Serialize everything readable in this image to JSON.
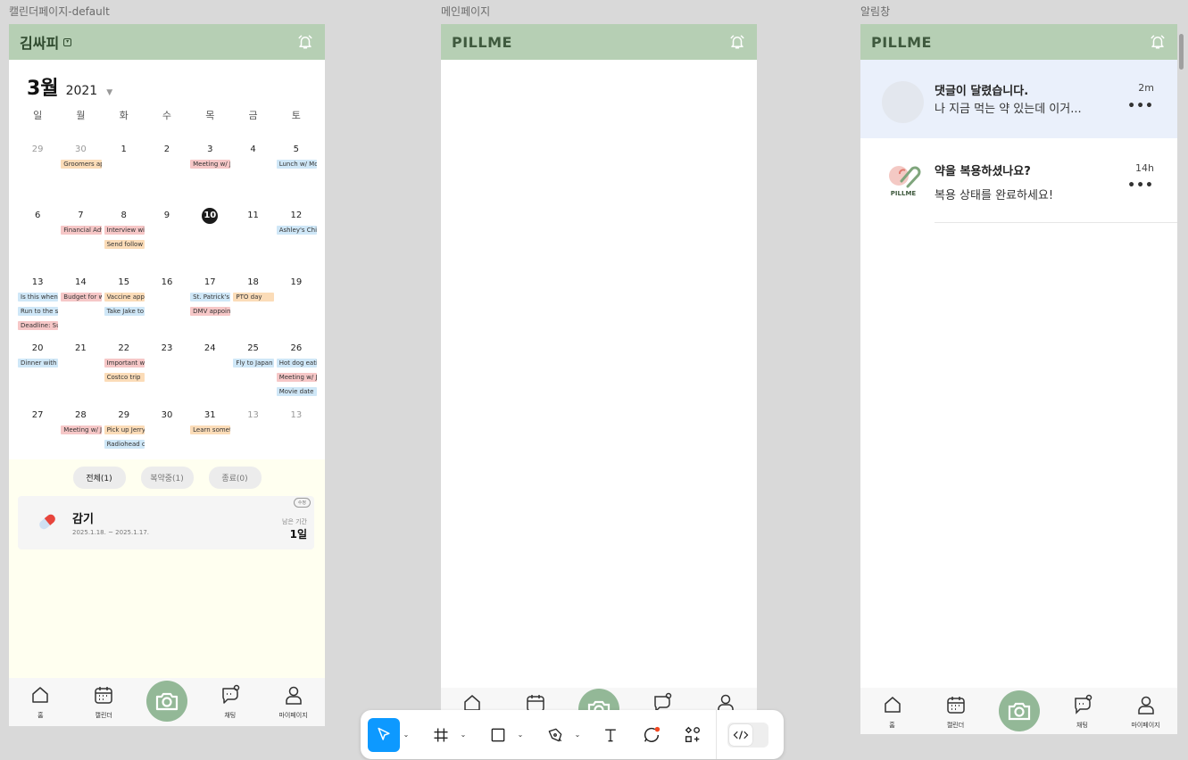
{
  "frames": {
    "calendar_label": "캘린더페이지-default",
    "main_label": "메인페이지",
    "notification_label": "알림창"
  },
  "colors": {
    "header": "#b6cfb4",
    "camera": "#93b897",
    "toolbar_active": "#0d99ff",
    "unread_bg": "#eaf0fb"
  },
  "calendar": {
    "user_name": "김싸피",
    "month": "3월",
    "year": "2021",
    "weekdays": [
      "일",
      "월",
      "화",
      "수",
      "목",
      "금",
      "토"
    ],
    "weeks": [
      [
        {
          "n": "29",
          "muted": true,
          "events": []
        },
        {
          "n": "30",
          "muted": true,
          "events": [
            {
              "t": "Groomers appt",
              "c": "orange"
            }
          ]
        },
        {
          "n": "1",
          "events": []
        },
        {
          "n": "2",
          "events": []
        },
        {
          "n": "3",
          "events": [
            {
              "t": "Meeting w/ Jo",
              "c": "pink"
            }
          ]
        },
        {
          "n": "4",
          "events": []
        },
        {
          "n": "5",
          "events": [
            {
              "t": "Lunch w/ Mom",
              "c": "blue"
            }
          ]
        }
      ],
      [
        {
          "n": "6",
          "events": []
        },
        {
          "n": "7",
          "events": [
            {
              "t": "Financial Advisor",
              "c": "pink"
            }
          ]
        },
        {
          "n": "8",
          "events": [
            {
              "t": "Interview with",
              "c": "pink"
            },
            {
              "t": "Send follow up",
              "c": "orange"
            }
          ]
        },
        {
          "n": "9",
          "events": []
        },
        {
          "n": "10",
          "today": true,
          "events": []
        },
        {
          "n": "11",
          "events": []
        },
        {
          "n": "12",
          "events": [
            {
              "t": "Ashley's Children",
              "c": "blue"
            }
          ]
        }
      ],
      [
        {
          "n": "13",
          "events": [
            {
              "t": "Is this when",
              "c": "blue"
            },
            {
              "t": "Run to the store",
              "c": "blue"
            },
            {
              "t": "Deadline: Submit",
              "c": "pink"
            }
          ]
        },
        {
          "n": "14",
          "events": [
            {
              "t": "Budget for week",
              "c": "pink"
            }
          ]
        },
        {
          "n": "15",
          "events": [
            {
              "t": "Vaccine appt",
              "c": "orange"
            },
            {
              "t": "Take Jake to",
              "c": "blue"
            }
          ]
        },
        {
          "n": "16",
          "events": []
        },
        {
          "n": "17",
          "events": [
            {
              "t": "St. Patrick's Day",
              "c": "blue"
            },
            {
              "t": "DMV appointment",
              "c": "pink"
            }
          ]
        },
        {
          "n": "18",
          "events": [
            {
              "t": "PTO day",
              "c": "orange"
            }
          ]
        },
        {
          "n": "19",
          "events": []
        }
      ],
      [
        {
          "n": "20",
          "events": [
            {
              "t": "Dinner with",
              "c": "blue"
            }
          ]
        },
        {
          "n": "21",
          "events": []
        },
        {
          "n": "22",
          "events": [
            {
              "t": "Important work",
              "c": "pink"
            },
            {
              "t": "Costco trip",
              "c": "orange"
            }
          ]
        },
        {
          "n": "23",
          "events": []
        },
        {
          "n": "24",
          "events": []
        },
        {
          "n": "25",
          "events": [
            {
              "t": "Fly to Japan",
              "c": "blue"
            }
          ]
        },
        {
          "n": "26",
          "events": [
            {
              "t": "Hot dog eating",
              "c": "blue"
            },
            {
              "t": "Meeting w/ Jo",
              "c": "pink"
            },
            {
              "t": "Movie date",
              "c": "blue"
            }
          ]
        }
      ],
      [
        {
          "n": "27",
          "events": []
        },
        {
          "n": "28",
          "events": [
            {
              "t": "Meeting w/ Jo",
              "c": "pink"
            }
          ]
        },
        {
          "n": "29",
          "events": [
            {
              "t": "Pick up Jerry",
              "c": "orange"
            },
            {
              "t": "Radiohead concert",
              "c": "blue"
            }
          ]
        },
        {
          "n": "30",
          "events": []
        },
        {
          "n": "31",
          "events": [
            {
              "t": "Learn something",
              "c": "orange"
            }
          ]
        },
        {
          "n": "13",
          "muted": true,
          "events": []
        },
        {
          "n": "13",
          "muted": true,
          "events": []
        }
      ]
    ],
    "filter_tabs": [
      "전체(1)",
      "복약중(1)",
      "종료(0)"
    ],
    "medication": {
      "name": "감기",
      "dates": "2025.1.18. ~ 2025.1.17.",
      "edit_label": "수정",
      "remaining_label": "남은 기간",
      "remaining_value": "1일"
    }
  },
  "brand": "PILLME",
  "nav": {
    "home": "홈",
    "calendar": "캘린더",
    "chat": "채팅",
    "mypage": "마이페이지"
  },
  "notifications": [
    {
      "title": "댓글이 달렸습니다.",
      "body": "나 지금 먹는 약 있는데 이거...",
      "time": "2m",
      "more": "•••"
    },
    {
      "title": "약을 복용하셨나요?",
      "body": "복용 상태를 완료하세요!",
      "time": "14h",
      "more": "•••",
      "avatar_text": "PILLME"
    }
  ]
}
